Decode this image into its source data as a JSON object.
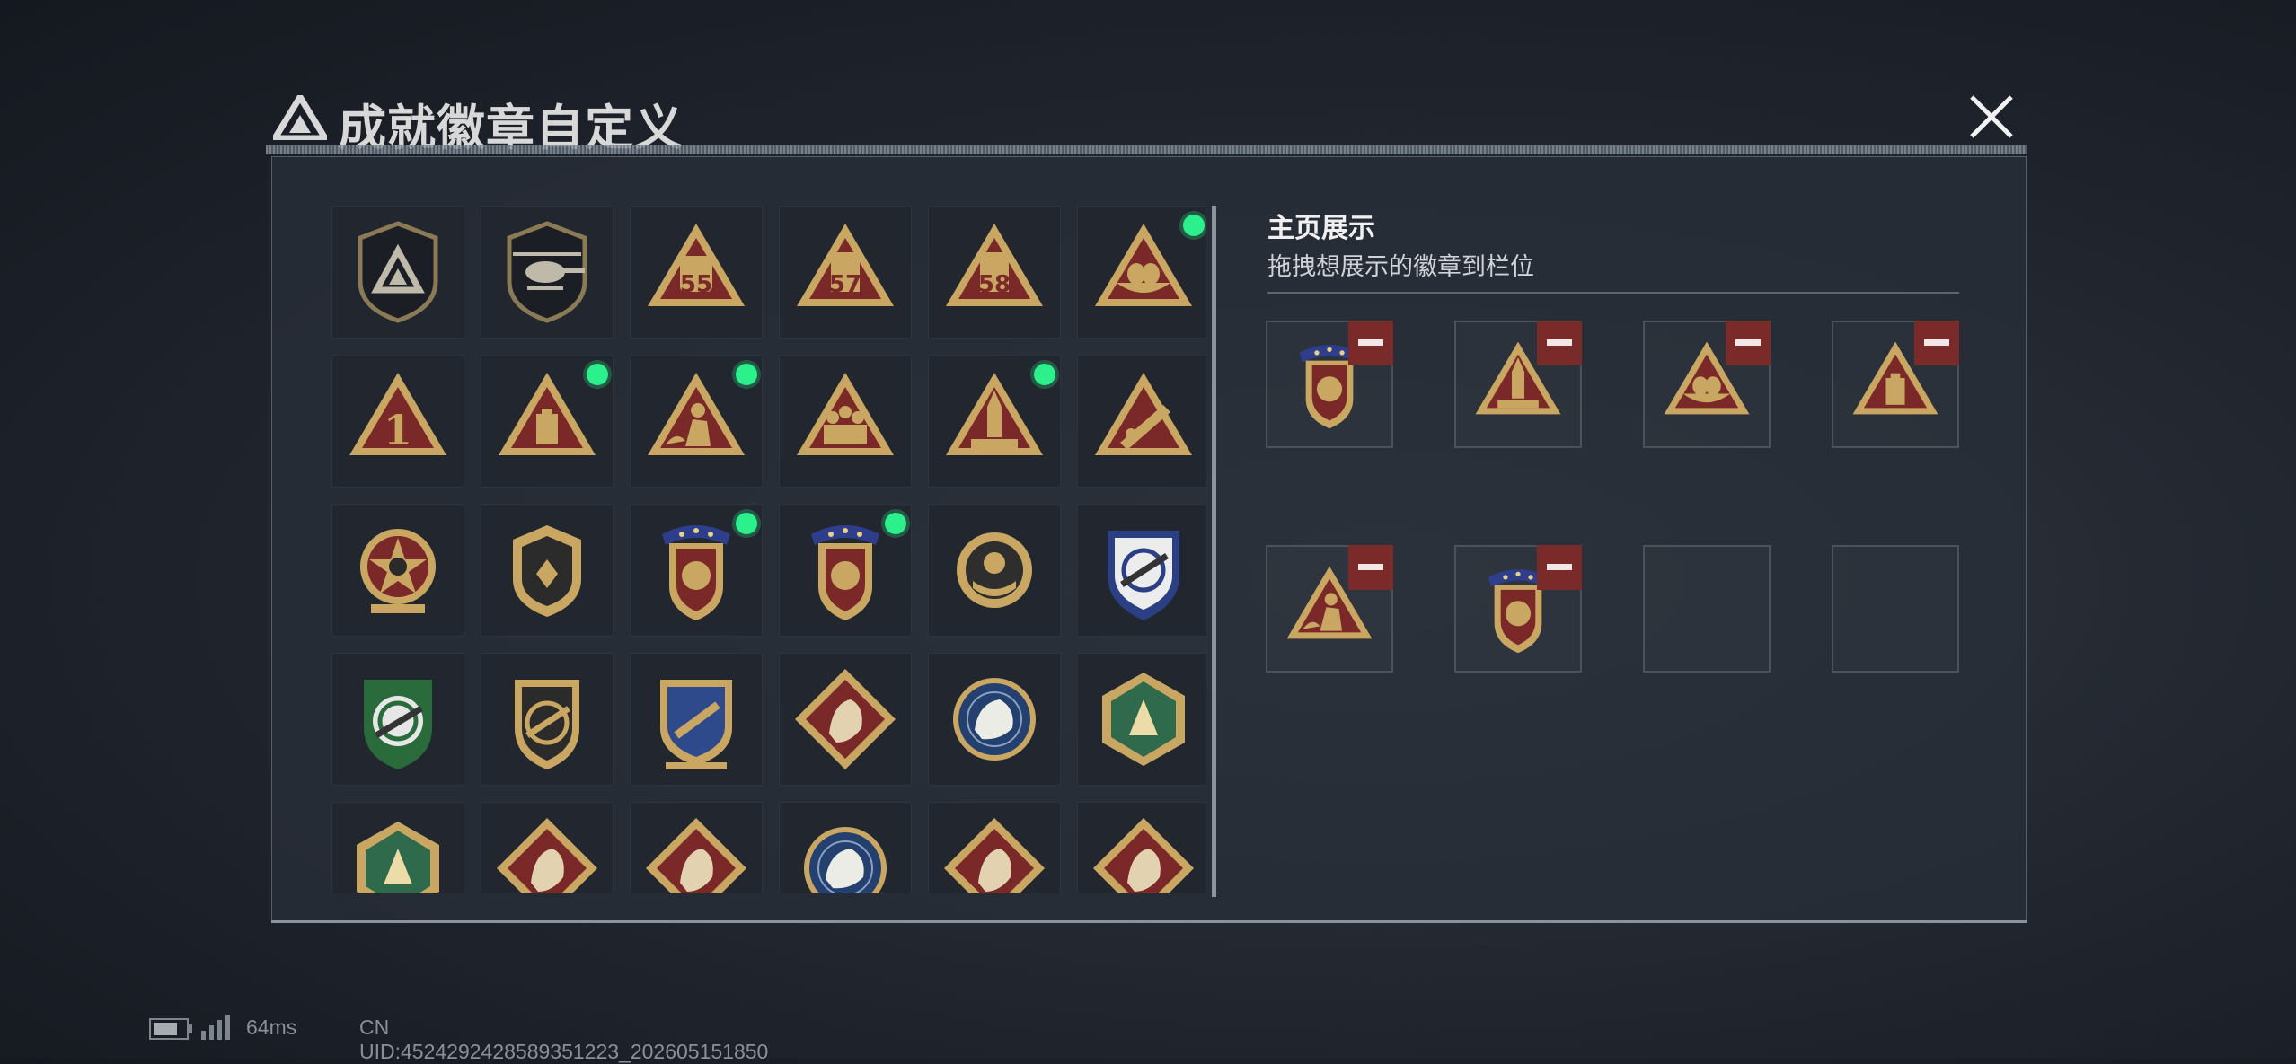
{
  "header": {
    "title": "成就徽章自定义",
    "close_icon": "close-icon"
  },
  "colors": {
    "gold": "#c9a762",
    "red": "#7a2828",
    "online_dot": "#2bf08c",
    "remove_red": "#7b2a2a"
  },
  "badges": [
    {
      "icon": "shield-logo-badge",
      "selected": false
    },
    {
      "icon": "helicopter-badge",
      "selected": false
    },
    {
      "icon": "level-55-badge",
      "selected": false
    },
    {
      "icon": "level-57-badge",
      "selected": false
    },
    {
      "icon": "level-58-badge",
      "selected": false
    },
    {
      "icon": "nest-eggs-badge",
      "selected": true
    },
    {
      "icon": "number-1-badge",
      "selected": false
    },
    {
      "icon": "cassette-badge",
      "selected": true
    },
    {
      "icon": "soldier-kneel-badge",
      "selected": true
    },
    {
      "icon": "squad-badge",
      "selected": false
    },
    {
      "icon": "rocket-badge",
      "selected": true
    },
    {
      "icon": "missile-badge",
      "selected": false
    },
    {
      "icon": "star-skull-medal",
      "selected": false
    },
    {
      "icon": "shield-emblem",
      "selected": false
    },
    {
      "icon": "crest-orb-emblem",
      "selected": true
    },
    {
      "icon": "crest-dice-emblem",
      "selected": true
    },
    {
      "icon": "round-hands-emblem",
      "selected": false
    },
    {
      "icon": "blue-crosshair-emblem",
      "selected": false
    },
    {
      "icon": "green-rifle-shield",
      "selected": false
    },
    {
      "icon": "rifle-target-shield",
      "selected": false
    },
    {
      "icon": "blue-gold-shield",
      "selected": false
    },
    {
      "icon": "wolf-diamond",
      "selected": false
    },
    {
      "icon": "eagle-circle",
      "selected": false
    },
    {
      "icon": "wasp-hexagon",
      "selected": false
    },
    {
      "icon": "medic-hexagon",
      "selected": false
    },
    {
      "icon": "dragon-diamond",
      "selected": false
    },
    {
      "icon": "runner-diamond",
      "selected": false
    },
    {
      "icon": "wolf-circle",
      "selected": false
    },
    {
      "icon": "horse-diamond",
      "selected": false
    },
    {
      "icon": "tools-diamond",
      "selected": false
    }
  ],
  "showcase": {
    "title": "主页展示",
    "subtitle": "拖拽想展示的徽章到栏位",
    "slots": [
      {
        "icon": "crest-dice-emblem"
      },
      {
        "icon": "rocket-badge"
      },
      {
        "icon": "nest-eggs-badge"
      },
      {
        "icon": "cassette-badge"
      },
      {
        "icon": "soldier-kneel-badge"
      },
      {
        "icon": "crest-orb-emblem"
      },
      {
        "icon": ""
      },
      {
        "icon": ""
      }
    ]
  },
  "status": {
    "ping": "64ms",
    "uid": "CN UID:4524292428589351223_202605151850"
  }
}
